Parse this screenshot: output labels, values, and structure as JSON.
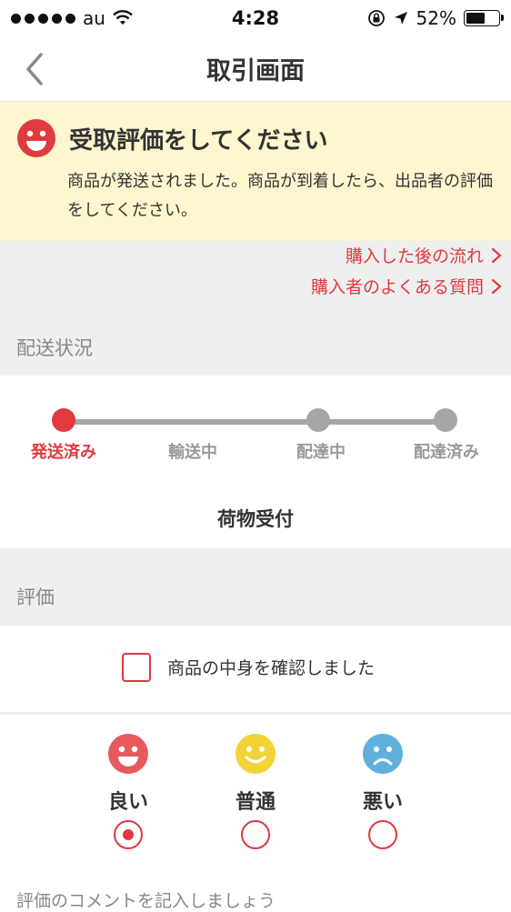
{
  "status_bar": {
    "carrier": "au",
    "time": "4:28",
    "battery": "52%",
    "battery_level": 0.52,
    "signal_bars": 5
  },
  "nav": {
    "title": "取引画面",
    "back_icon": "chevron-left-icon"
  },
  "banner": {
    "title": "受取評価をしてください",
    "body": "商品が発送されました。商品が到着したら、出品者の評価をしてください。",
    "icon": "smile-face-icon",
    "background": "#fdf6cf"
  },
  "links": [
    {
      "label": "購入した後の流れ",
      "icon": "chevron-right-icon"
    },
    {
      "label": "購入者のよくある質問",
      "icon": "chevron-right-icon"
    }
  ],
  "shipping": {
    "section_label": "配送状況",
    "steps": [
      "発送済み",
      "輸送中",
      "配達中",
      "配達済み"
    ],
    "current_step": 0,
    "status": "荷物受付"
  },
  "evaluation": {
    "section_label": "評価",
    "confirm_label": "商品の中身を確認しました",
    "confirm_checked": false,
    "options": [
      {
        "label": "良い",
        "icon": "happy-face-icon",
        "color": "#e8595e",
        "selected": true
      },
      {
        "label": "普通",
        "icon": "neutral-smile-face-icon",
        "color": "#f2d33a",
        "selected": false
      },
      {
        "label": "悪い",
        "icon": "sad-face-icon",
        "color": "#5fb1dc",
        "selected": false
      }
    ],
    "comment_prompt": "評価のコメントを記入しましょう"
  },
  "colors": {
    "accent": "#e0393e",
    "muted": "#a6a6a6",
    "section_bg": "#efefef"
  }
}
